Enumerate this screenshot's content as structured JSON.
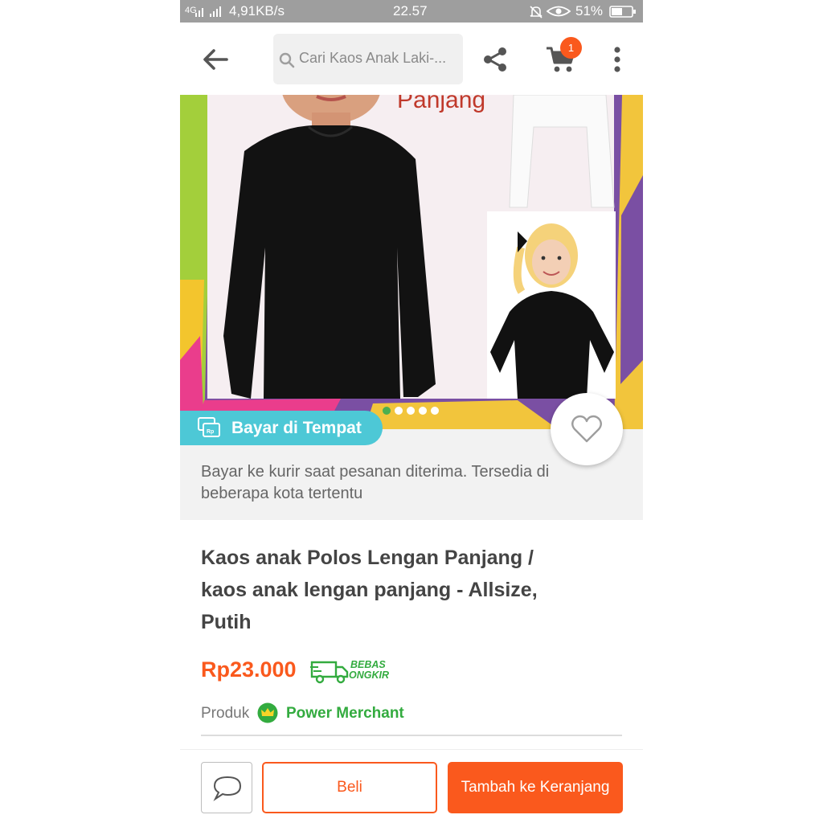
{
  "status_bar": {
    "network": "4G",
    "speed": "4,91KB/s",
    "time": "22.57",
    "battery": "51%"
  },
  "app_bar": {
    "back_icon": "arrow-left-icon",
    "search_placeholder": "Cari Kaos Anak Laki-...",
    "share_icon": "share-icon",
    "cart_icon": "cart-icon",
    "cart_count": "1",
    "more_icon": "more-vertical-icon"
  },
  "banner": {
    "partial_text": "Panjang",
    "carousel_count": 5,
    "carousel_active": 0
  },
  "cod": {
    "label": "Bayar di Tempat",
    "description": "Bayar ke kurir saat pesanan diterima. Tersedia di beberapa kota tertentu"
  },
  "product": {
    "title": "Kaos anak Polos Lengan Panjang / kaos anak lengan panjang - Allsize, Putih",
    "price": "Rp23.000",
    "shipping_badge_line1": "BEBAS",
    "shipping_badge_line2": "ONGKIR",
    "seller_prefix": "Produk",
    "seller_badge": "Power Merchant"
  },
  "actions": {
    "buy": "Beli",
    "add_to_cart": "Tambah ke Keranjang"
  },
  "colors": {
    "accent": "#fa591d",
    "cod": "#4dc8d6",
    "merchant_green": "#33ab3f",
    "status_bar": "#9e9e9e"
  }
}
